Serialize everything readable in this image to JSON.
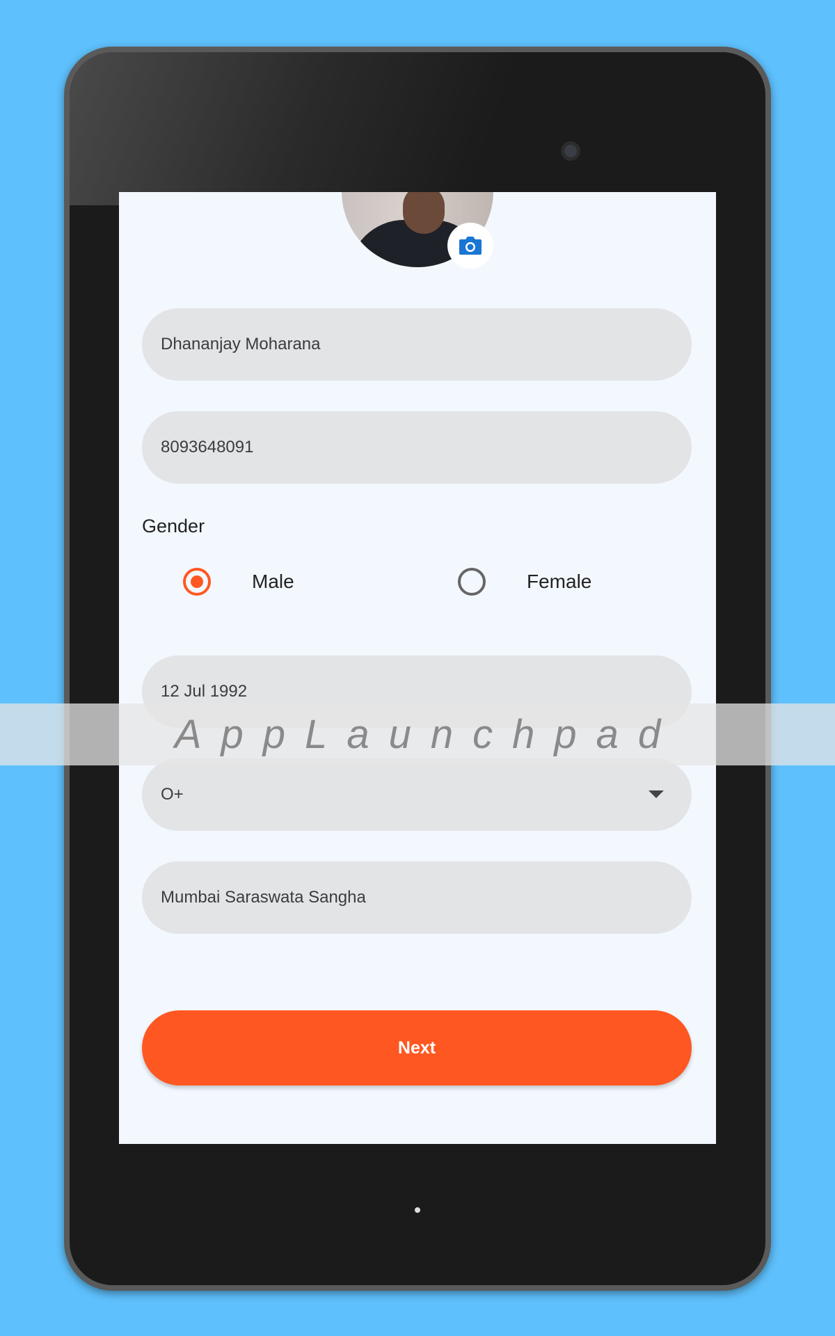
{
  "profile": {
    "avatar_icon": "profile-photo",
    "camera_icon": "camera-icon"
  },
  "form": {
    "name": "Dhananjay Moharana",
    "phone": "8093648091",
    "gender_label": "Gender",
    "gender_options": [
      {
        "label": "Male",
        "selected": true
      },
      {
        "label": "Female",
        "selected": false
      }
    ],
    "dob": "12 Jul 1992",
    "blood_group": "O+",
    "organization": "Mumbai Saraswata Sangha",
    "next_label": "Next"
  },
  "watermark": "AppLaunchpad",
  "colors": {
    "accent": "#ff5722",
    "background": "#5ec0fc",
    "camera": "#1976d2"
  }
}
